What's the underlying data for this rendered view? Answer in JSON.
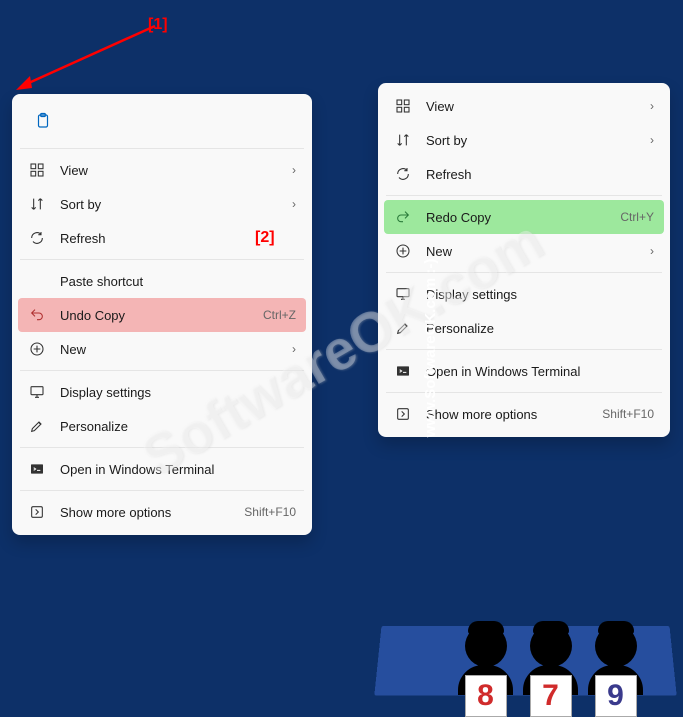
{
  "annotations": {
    "label1": "[1]",
    "label2": "[2]"
  },
  "watermark": {
    "main": "SoftwareOK.com",
    "side": "www.SoftwareOK.com :-)"
  },
  "judges": {
    "scores": [
      "8",
      "7",
      "9"
    ]
  },
  "menu_left": {
    "items": [
      {
        "label": "View",
        "has_chevron": true
      },
      {
        "label": "Sort by",
        "has_chevron": true
      },
      {
        "label": "Refresh"
      },
      {
        "label": "Paste shortcut"
      },
      {
        "label": "Undo Copy",
        "shortcut": "Ctrl+Z",
        "highlight": "red"
      },
      {
        "label": "New",
        "has_chevron": true
      },
      {
        "label": "Display settings"
      },
      {
        "label": "Personalize"
      },
      {
        "label": "Open in Windows Terminal"
      },
      {
        "label": "Show more options",
        "shortcut": "Shift+F10"
      }
    ]
  },
  "menu_right": {
    "items": [
      {
        "label": "View",
        "has_chevron": true
      },
      {
        "label": "Sort by",
        "has_chevron": true
      },
      {
        "label": "Refresh"
      },
      {
        "label": "Redo Copy",
        "shortcut": "Ctrl+Y",
        "highlight": "green"
      },
      {
        "label": "New",
        "has_chevron": true
      },
      {
        "label": "Display settings"
      },
      {
        "label": "Personalize"
      },
      {
        "label": "Open in Windows Terminal"
      },
      {
        "label": "Show more options",
        "shortcut": "Shift+F10"
      }
    ]
  }
}
